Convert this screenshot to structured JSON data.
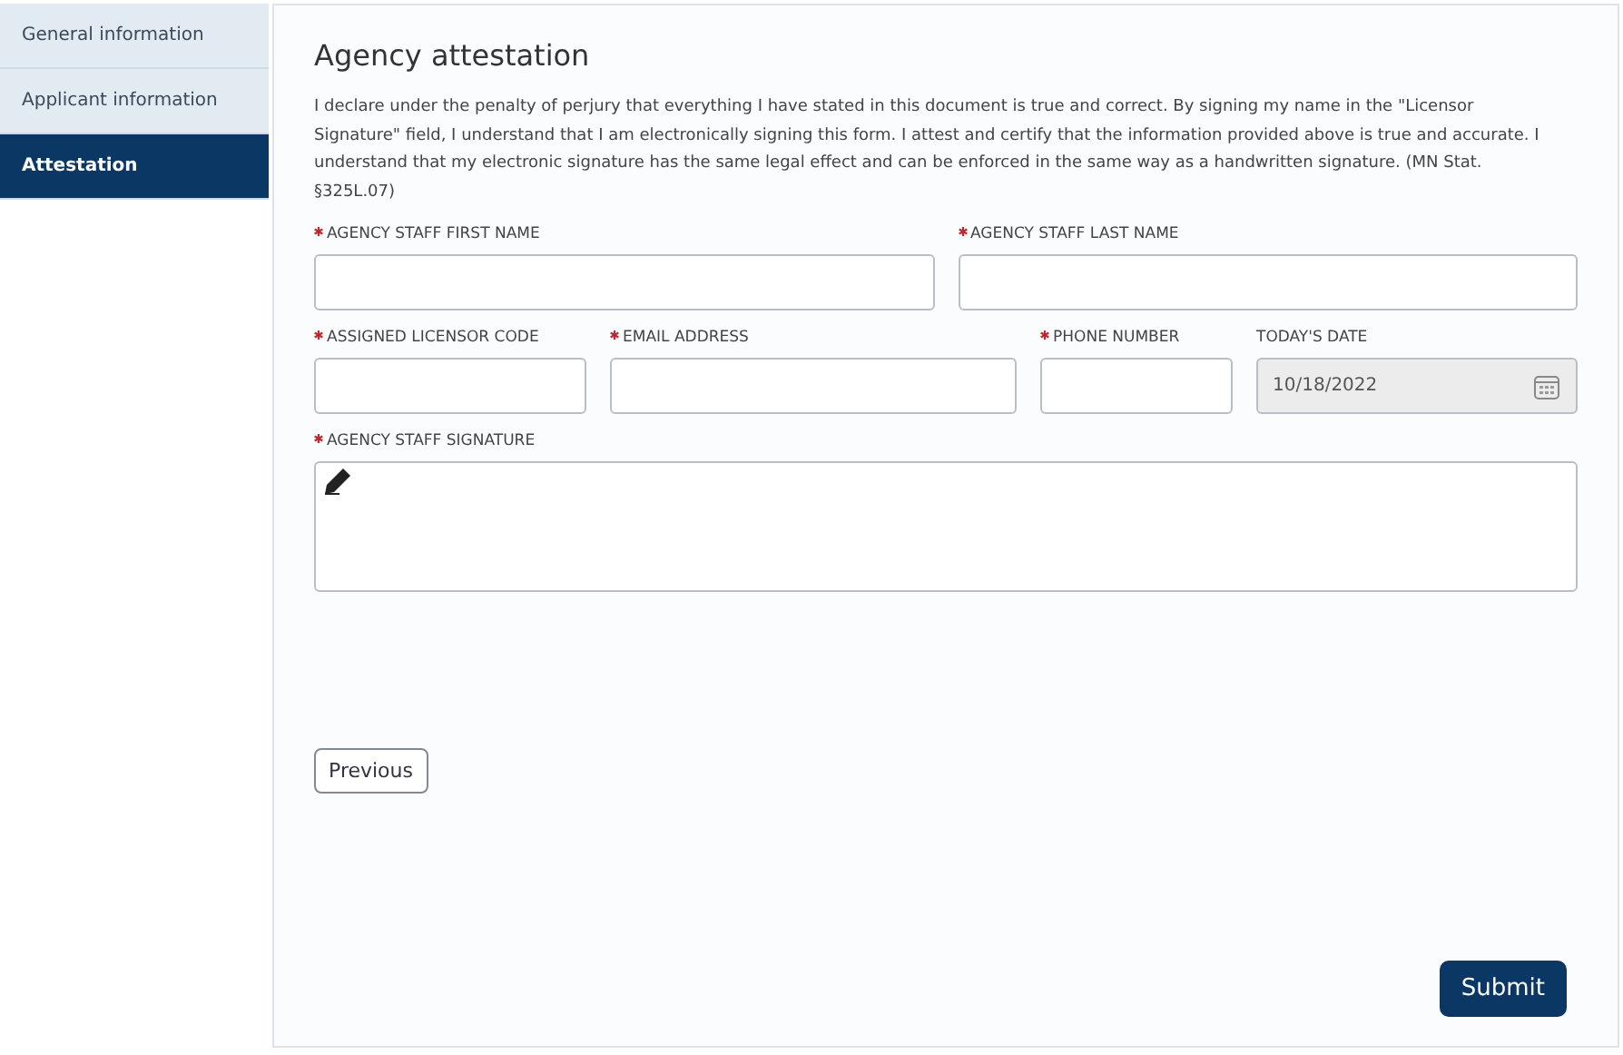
{
  "sidebar": {
    "items": [
      {
        "label": "General information",
        "selected": false
      },
      {
        "label": "Applicant information",
        "selected": false
      },
      {
        "label": "Attestation",
        "selected": true
      }
    ]
  },
  "form": {
    "title": "Agency attestation",
    "statement": "I declare under the penalty of perjury that everything I have stated in this document is true and correct. By signing my name in the \"Licensor Signature\" field, I understand that I am electronically signing this form. I attest and certify that the information provided above is true and accurate. I understand that my electronic signature has the same legal effect and can be enforced in the same way as a handwritten signature. (MN Stat. §325L.07)",
    "sections": [
      {
        "fields": [
          {
            "label": "AGENCY STAFF FIRST NAME",
            "required": true,
            "kind": "text"
          },
          {
            "label": "AGENCY STAFF LAST NAME",
            "required": true,
            "kind": "text"
          }
        ]
      },
      {
        "fields": [
          {
            "label": "ASSIGNED LICENSOR CODE",
            "required": true,
            "kind": "text"
          },
          {
            "label": "EMAIL ADDRESS",
            "required": true,
            "kind": "text"
          },
          {
            "label": "PHONE NUMBER",
            "required": true,
            "kind": "text"
          },
          {
            "label": "TODAY'S DATE",
            "required": false,
            "kind": "date",
            "value": "10/18/2022"
          }
        ]
      },
      {
        "fields": [
          {
            "label": "AGENCY STAFF SIGNATURE",
            "required": true,
            "kind": "signature"
          }
        ]
      }
    ],
    "buttons": {
      "previous": "Previous",
      "submit": "Submit"
    }
  }
}
